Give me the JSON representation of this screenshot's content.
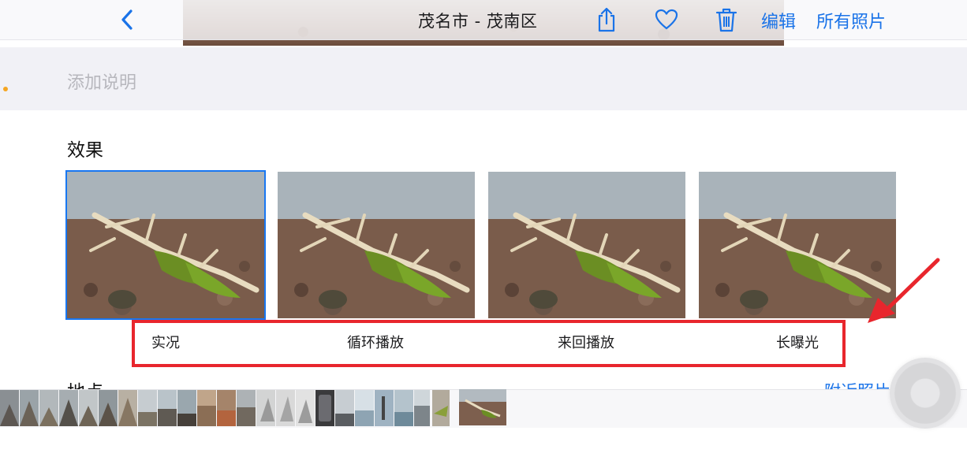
{
  "navbar": {
    "title": "茂名市 - 茂南区",
    "edit_label": "编辑",
    "all_photos_label": "所有照片",
    "icons": [
      "chevron-left-icon",
      "share-icon",
      "heart-icon",
      "trash-icon"
    ]
  },
  "caption": {
    "placeholder": "添加说明"
  },
  "effects": {
    "title": "效果",
    "items": [
      {
        "label": "实况",
        "selected": true
      },
      {
        "label": "循环播放",
        "selected": false
      },
      {
        "label": "来回播放",
        "selected": false
      },
      {
        "label": "长曝光",
        "selected": false
      }
    ]
  },
  "places": {
    "title": "地点",
    "nearby_label": "附近照片"
  },
  "colors": {
    "accent": "#1a73e8",
    "highlight": "#e8262d",
    "selection": "#1877f2"
  }
}
